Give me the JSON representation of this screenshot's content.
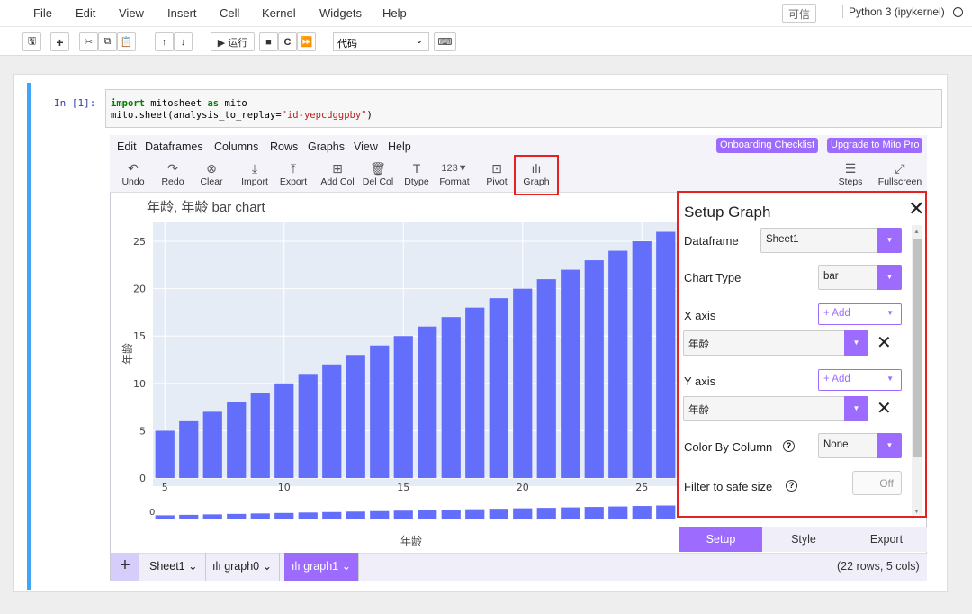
{
  "menubar": {
    "items": [
      "File",
      "Edit",
      "View",
      "Insert",
      "Cell",
      "Kernel",
      "Widgets",
      "Help"
    ],
    "trusted": "可信",
    "kernel": "Python 3 (ipykernel)"
  },
  "toolbar": {
    "run_label": "▶ 运行",
    "cell_type": "代码"
  },
  "cell": {
    "prompt": "In  [1]:",
    "code_line1_kw": "import",
    "code_line1_rest": " mitosheet ",
    "code_line1_kw2": "as",
    "code_line1_end": " mito",
    "code_line2_start": "mito.sheet(analysis_to_replay=",
    "code_line2_str": "\"id-yepcdggpby\"",
    "code_line2_end": ")"
  },
  "mito": {
    "menu": [
      "Edit",
      "Dataframes",
      "Columns",
      "Rows",
      "Graphs",
      "View",
      "Help"
    ],
    "onboarding": "Onboarding Checklist",
    "upgrade": "Upgrade to Mito Pro",
    "tools": {
      "undo": "Undo",
      "redo": "Redo",
      "clear": "Clear",
      "import": "Import",
      "export": "Export",
      "add_col": "Add Col",
      "del_col": "Del Col",
      "dtype": "Dtype",
      "format": "Format",
      "format_icon": "123▼",
      "pivot": "Pivot",
      "graph": "Graph",
      "steps": "Steps",
      "fullscreen": "Fullscreen"
    },
    "footer": {
      "sheet1": "Sheet1 ⌄",
      "graph0": "ılı graph0 ⌄",
      "graph1": "ılı graph1 ⌄",
      "rows_cols": "(22 rows, 5 cols)"
    }
  },
  "setup_graph": {
    "title": "Setup Graph",
    "dataframe_label": "Dataframe",
    "dataframe_value": "Sheet1",
    "chart_type_label": "Chart Type",
    "chart_type_value": "bar",
    "x_axis_label": "X axis",
    "x_axis_value": "年龄",
    "y_axis_label": "Y axis",
    "y_axis_value": "年龄",
    "add_label": "+ Add",
    "color_by_label": "Color By Column",
    "color_by_value": "None",
    "filter_label": "Filter to safe size",
    "filter_toggle": "Off",
    "tabs": [
      "Setup",
      "Style",
      "Export"
    ]
  },
  "chart_data": {
    "type": "bar",
    "title": "年龄, 年龄 bar chart",
    "xlabel": "年龄",
    "ylabel": "年龄",
    "x": [
      5,
      6,
      7,
      8,
      9,
      10,
      11,
      12,
      13,
      14,
      15,
      16,
      17,
      18,
      19,
      20,
      21,
      22,
      23,
      24,
      25,
      26
    ],
    "values": [
      5,
      6,
      7,
      8,
      9,
      10,
      11,
      12,
      13,
      14,
      15,
      16,
      17,
      18,
      19,
      20,
      21,
      22,
      23,
      24,
      25,
      26
    ],
    "x_ticks": [
      "5",
      "10",
      "15",
      "20",
      "25"
    ],
    "y_ticks": [
      "0",
      "5",
      "10",
      "15",
      "20",
      "25"
    ],
    "ylim": [
      0,
      27
    ],
    "bar_color": "#636efa",
    "grid": true
  }
}
